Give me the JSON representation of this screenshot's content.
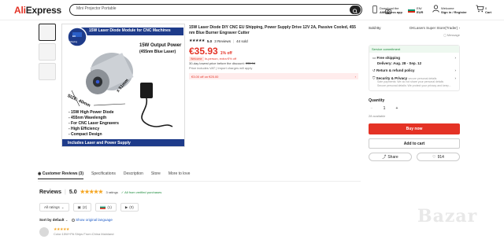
{
  "header": {
    "logo_prefix": "Ali",
    "logo_suffix": "Express",
    "search_value": "Mini Projector Portable",
    "download_line1": "Download the",
    "download_line2": "AliExpress app",
    "region_line1": "EN/",
    "region_line2": "EUR",
    "account_line1": "Welcome",
    "account_line2": "Sign in / Register",
    "cart_count": "0",
    "cart_label": "Cart"
  },
  "product": {
    "title": "15W Laser Diode DIY CNC EU Shipping, Power Supply Drive 12V 2A, Passive Cooled, 455 nm Blue Burner Engraver Cutter",
    "rating_value": "5.0",
    "reviews_count": "3 Reviews",
    "sold_count": "44 sold",
    "price": "€35.93",
    "discount": "1% off",
    "welcome_deal": "Welcome",
    "price_note_1": "In-person, extra €% off",
    "lowest_price_note": "30-day lowest price before the discount:",
    "old_price": "€35.94",
    "vat_note": "Price includes VAT | Import charges will apply",
    "coupon_text": "€3.00 off on €25.00",
    "coupon_arrow": "›"
  },
  "image": {
    "banner": "15W Laser Diode Module for CNC Machines",
    "badge_top": "EU",
    "badge_bottom": "Shipping",
    "output_title": "15W Output Power",
    "output_sub": "(455nm Blue Laser)",
    "size_label": "SIZE: 40mm",
    "size_label2": "x 51mm",
    "features": [
      "- 15W High Power Diode",
      "- 455nm Wavelength",
      "- For CNC Laser Engravers",
      "- High Efficiency",
      "- Compact Design"
    ],
    "footer": "Includes Laser and Power Supply"
  },
  "sidebar": {
    "sold_by_label": "Sold By",
    "seller": "DKLasers Super Store(Trader)",
    "message": "Message",
    "commitment": "Service commitment",
    "shipping_label": "Free shipping",
    "delivery": "Delivery: Aug. 28 - Sep. 12",
    "return_label": "Return & refund policy",
    "security_label": "Security & Privacy",
    "security_sub": "secure personal details",
    "security_line1": "Safe payments: We do not share your personal details",
    "security_line2": "Secure personal details: We protect your privacy and keep...",
    "quantity_label": "Quantity",
    "quantity_value": "1",
    "available": "28 available",
    "buy_now": "Buy now",
    "add_to_cart": "Add to cart",
    "share": "Share",
    "wishlist_count": "914"
  },
  "tabs": [
    "Customer Reviews (3)",
    "Specifications",
    "Description",
    "Store",
    "More to love"
  ],
  "reviews": {
    "title": "Reviews",
    "score": "5.0",
    "ratings": "3 ratings",
    "verified": "All from verified purchases",
    "filters": [
      "All ratings",
      "(2)",
      "(1)",
      "(0)"
    ],
    "sort_label": "Sort by default",
    "sort_link": "Show original language",
    "first_review_meta": "Color:15W+PA Ships From:China Mainland"
  },
  "watermark": "Bazar"
}
